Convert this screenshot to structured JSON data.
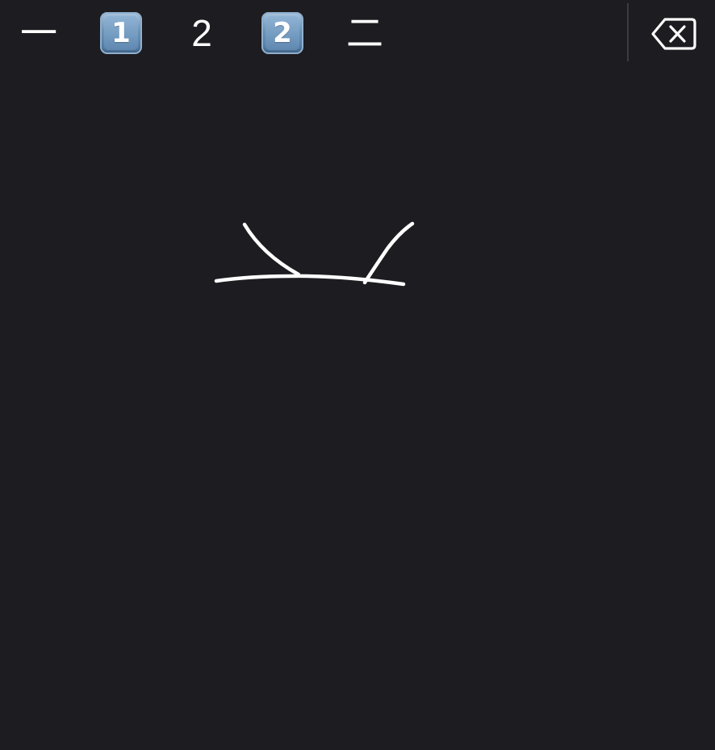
{
  "candidates": [
    {
      "label": "一",
      "kind": "text"
    },
    {
      "label": "1",
      "kind": "keycap"
    },
    {
      "label": "2",
      "kind": "text"
    },
    {
      "label": "2",
      "kind": "keycap"
    },
    {
      "label": "二",
      "kind": "text"
    }
  ],
  "delete_key": {
    "icon": "backspace-icon"
  },
  "colors": {
    "background": "#1d1c20",
    "ink": "#ffffff",
    "keycap": "#6f95b8"
  }
}
